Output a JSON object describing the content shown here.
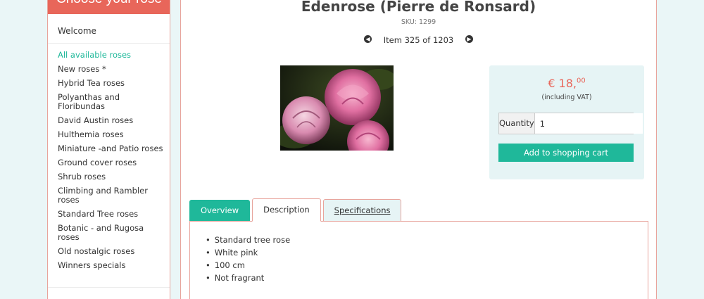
{
  "sidebar": {
    "title": "Choose your rose",
    "welcome": "Welcome",
    "items": [
      {
        "label": "All available roses",
        "active": true
      },
      {
        "label": "New roses *"
      },
      {
        "label": "Hybrid Tea roses"
      },
      {
        "label": "Polyanthas and Floribundas"
      },
      {
        "label": "David Austin roses"
      },
      {
        "label": "Hulthemia roses"
      },
      {
        "label": "Miniature -and Patio roses"
      },
      {
        "label": "Ground cover roses"
      },
      {
        "label": "Shrub roses"
      },
      {
        "label": "Climbing and Rambler roses"
      },
      {
        "label": "Standard Tree roses"
      },
      {
        "label": "Botanic - and Rugosa roses"
      },
      {
        "label": "Old nostalgic roses"
      },
      {
        "label": "Winners specials"
      }
    ]
  },
  "product": {
    "title": "Edenrose (Pierre de Ronsard)",
    "sku": "SKU: 1299",
    "nav_label": "Item 325 of 1203",
    "price_main": "€ 18,",
    "price_cents": "00",
    "vat_note": "(including VAT)",
    "quantity_label": "Quantity",
    "quantity_value": "1",
    "add_to_cart": "Add to shopping cart"
  },
  "tabs": [
    {
      "label": "Overview"
    },
    {
      "label": "Description"
    },
    {
      "label": "Specifications"
    }
  ],
  "description_items": [
    "Standard tree rose",
    "White pink",
    "100 cm",
    "Not fragrant"
  ],
  "colors": {
    "accent": "#1fb89a",
    "brand": "#e8665a",
    "panel": "#e6f4f5"
  }
}
